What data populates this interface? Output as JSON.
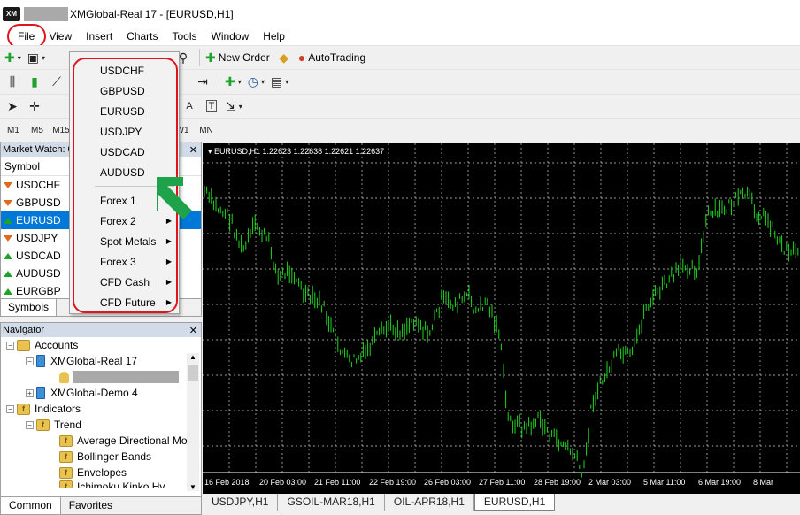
{
  "window": {
    "title": "XMGlobal-Real 17 - [EURUSD,H1]",
    "logo_text": "XM"
  },
  "menu": [
    "File",
    "View",
    "Insert",
    "Charts",
    "Tools",
    "Window",
    "Help"
  ],
  "toolbar": {
    "new_order": "New Order",
    "autotrading": "AutoTrading",
    "timeframes": [
      "M1",
      "M5",
      "M15",
      "W1",
      "MN"
    ],
    "text_tool": "A",
    "label_tool": "T"
  },
  "market_watch": {
    "title": "Market Watch: 0",
    "column": "Symbol",
    "rows": [
      {
        "symbol": "USDCHF",
        "dir": "down"
      },
      {
        "symbol": "GBPUSD",
        "dir": "down"
      },
      {
        "symbol": "EURUSD",
        "dir": "up",
        "selected": true
      },
      {
        "symbol": "USDJPY",
        "dir": "down"
      },
      {
        "symbol": "USDCAD",
        "dir": "up"
      },
      {
        "symbol": "AUDUSD",
        "dir": "up"
      },
      {
        "symbol": "EURGBP",
        "dir": "up"
      }
    ],
    "tab": "Symbols"
  },
  "navigator": {
    "title": "Navigator",
    "accounts": "Accounts",
    "real_account": "XMGlobal-Real 17",
    "demo_account": "XMGlobal-Demo 4",
    "indicators": "Indicators",
    "trend": "Trend",
    "items": [
      "Average Directional Mo",
      "Bollinger Bands",
      "Envelopes",
      "Ichimoku Kinko Hy"
    ],
    "tabs": [
      "Common",
      "Favorites"
    ]
  },
  "dropdown": {
    "symbols": [
      "USDCHF",
      "GBPUSD",
      "EURUSD",
      "USDJPY",
      "USDCAD",
      "AUDUSD"
    ],
    "groups": [
      {
        "label": "Forex 1",
        "submenu": false
      },
      {
        "label": "Forex 2",
        "submenu": true
      },
      {
        "label": "Spot Metals",
        "submenu": true
      },
      {
        "label": "Forex 3",
        "submenu": true
      },
      {
        "label": "CFD Cash",
        "submenu": true
      },
      {
        "label": "CFD Future",
        "submenu": true
      }
    ]
  },
  "chart": {
    "info": "EURUSD,H1  1.22623 1.22638 1.22621 1.22637",
    "x_labels": [
      "16 Feb 2018",
      "20 Feb 03:00",
      "21 Feb 11:00",
      "22 Feb 19:00",
      "26 Feb 03:00",
      "27 Feb 11:00",
      "28 Feb 19:00",
      "2 Mar 03:00",
      "5 Mar 11:00",
      "6 Mar 19:00",
      "8 Mar"
    ],
    "tabs": [
      "USDJPY,H1",
      "GSOIL-MAR18,H1",
      "OIL-APR18,H1",
      "EURUSD,H1"
    ],
    "active_tab": 3
  },
  "colors": {
    "candle": "#1fd81f",
    "grid": "#cfcfcf",
    "highlight": "#e0141b",
    "selected_row": "#0078d7"
  }
}
